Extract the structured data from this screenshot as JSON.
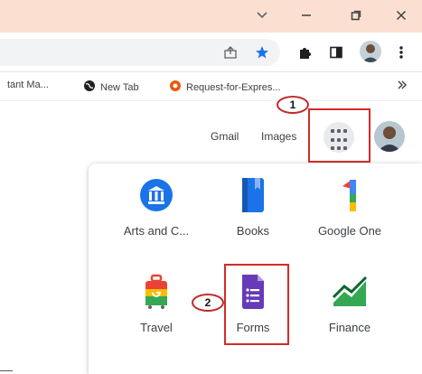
{
  "titlebar": {
    "bg": "#fbe0d1",
    "icons": [
      "chevron-down-icon",
      "minimize-icon",
      "restore-icon",
      "close-icon"
    ]
  },
  "toolbar": {
    "omnibox_icons": [
      "share-icon",
      "bookmark-star-icon"
    ],
    "icons": [
      "extensions-puzzle-icon",
      "side-panel-icon",
      "profile-avatar",
      "menu-dots-icon"
    ],
    "accent": "#1a73e8"
  },
  "bookmarks": [
    {
      "label": "tant Ma...",
      "icon": "none"
    },
    {
      "label": "New Tab",
      "icon": "globe-icon"
    },
    {
      "label": "Request-for-Expres...",
      "icon": "orange-record-icon"
    }
  ],
  "bookmarks_overflow_icon": "double-chevron-right-icon",
  "header": {
    "gmail_label": "Gmail",
    "images_label": "Images"
  },
  "callouts": {
    "one": "1",
    "two": "2"
  },
  "highlight_color": "#d62a2a",
  "apps": [
    {
      "label": "Arts and C...",
      "icon": "arts-culture-icon"
    },
    {
      "label": "Books",
      "icon": "books-icon"
    },
    {
      "label": "Google One",
      "icon": "google-one-icon"
    },
    {
      "label": "Travel",
      "icon": "travel-icon"
    },
    {
      "label": "Forms",
      "icon": "forms-icon"
    },
    {
      "label": "Finance",
      "icon": "finance-icon"
    }
  ]
}
